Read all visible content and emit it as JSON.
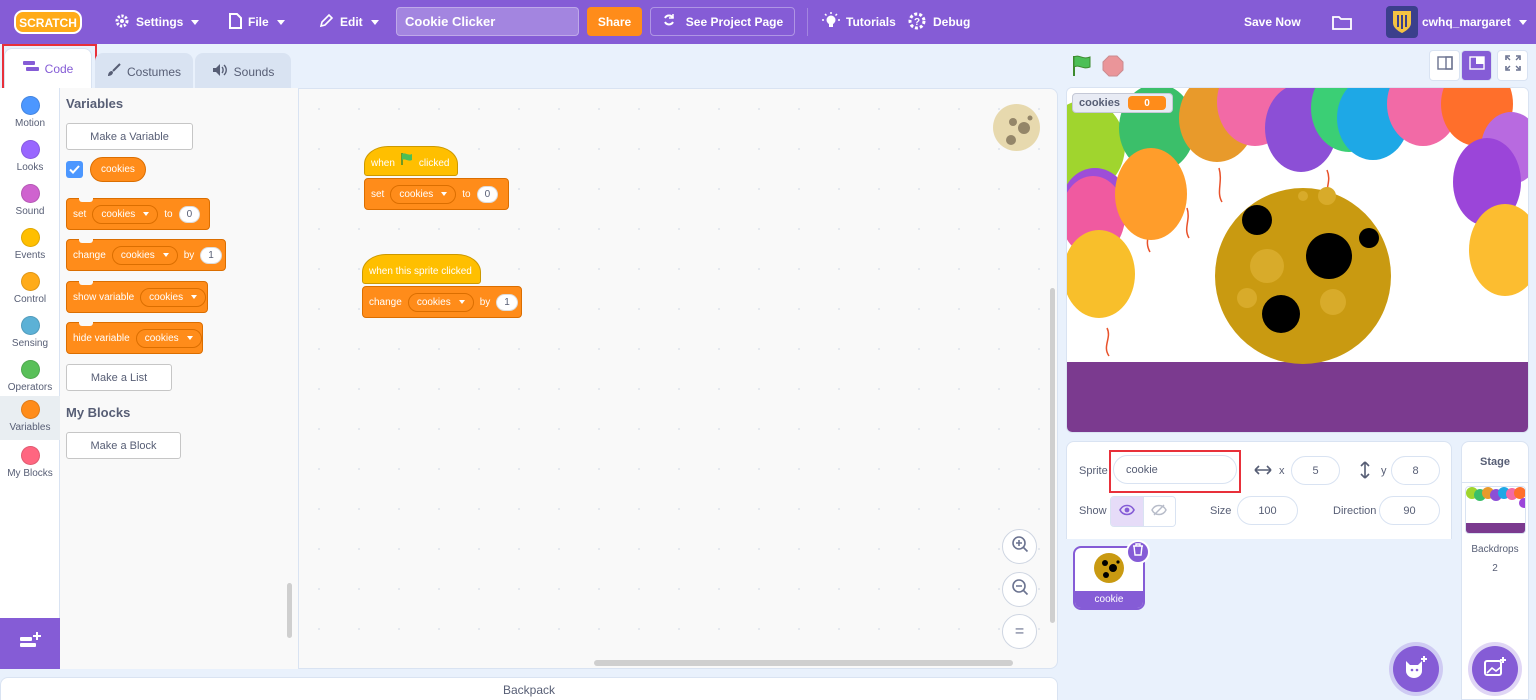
{
  "menubar": {
    "logo": "SCRATCH",
    "settings": "Settings",
    "file": "File",
    "edit": "Edit",
    "project_title": "Cookie Clicker",
    "share": "Share",
    "see_project_page": "See Project Page",
    "tutorials": "Tutorials",
    "debug": "Debug",
    "save_now": "Save Now",
    "username": "cwhq_margaret",
    "accent": "#855cd6"
  },
  "tabs": {
    "code": "Code",
    "costumes": "Costumes",
    "sounds": "Sounds"
  },
  "categories": [
    {
      "label": "Motion",
      "color": "#4c97ff"
    },
    {
      "label": "Looks",
      "color": "#9966ff"
    },
    {
      "label": "Sound",
      "color": "#cf63cf"
    },
    {
      "label": "Events",
      "color": "#ffbf00"
    },
    {
      "label": "Control",
      "color": "#ffab19"
    },
    {
      "label": "Sensing",
      "color": "#5cb1d6"
    },
    {
      "label": "Operators",
      "color": "#59c059"
    },
    {
      "label": "Variables",
      "color": "#ff8c1a"
    },
    {
      "label": "My Blocks",
      "color": "#ff6680"
    }
  ],
  "palette": {
    "variables_heading": "Variables",
    "make_variable": "Make a Variable",
    "variable_reporter": "cookies",
    "set_block": {
      "verb": "set",
      "var": "cookies",
      "prep": "to",
      "value": "0"
    },
    "change_block": {
      "verb": "change",
      "var": "cookies",
      "prep": "by",
      "value": "1"
    },
    "show_block": {
      "verb": "show variable",
      "var": "cookies"
    },
    "hide_block": {
      "verb": "hide variable",
      "var": "cookies"
    },
    "make_list": "Make a List",
    "my_blocks_heading": "My Blocks",
    "make_block": "Make a Block"
  },
  "workspace": {
    "script1": {
      "hat_when": "when",
      "hat_clicked": "clicked",
      "set_verb": "set",
      "set_var": "cookies",
      "set_prep": "to",
      "set_value": "0"
    },
    "script2": {
      "hat": "when this sprite clicked",
      "change_verb": "change",
      "change_var": "cookies",
      "change_prep": "by",
      "change_value": "1"
    },
    "zoom_reset": "="
  },
  "backpack": "Backpack",
  "stage": {
    "monitor_label": "cookies",
    "monitor_value": "0"
  },
  "sprite_info": {
    "sprite_label": "Sprite",
    "sprite_name": "cookie",
    "x_label": "x",
    "x_value": "5",
    "y_label": "y",
    "y_value": "8",
    "show_label": "Show",
    "size_label": "Size",
    "size_value": "100",
    "direction_label": "Direction",
    "direction_value": "90",
    "thumb_name": "cookie"
  },
  "stage_pane": {
    "title": "Stage",
    "backdrops_label": "Backdrops",
    "backdrops_count": "2"
  }
}
